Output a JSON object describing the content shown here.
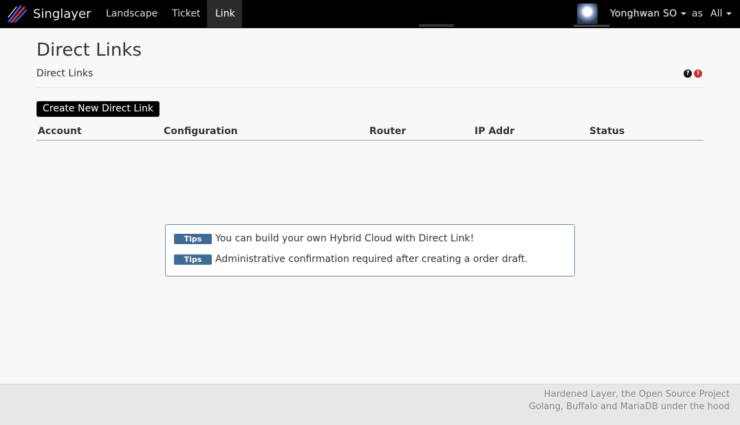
{
  "navbar": {
    "brand": "Singlayer",
    "items": [
      {
        "label": "Landscape",
        "active": false
      },
      {
        "label": "Ticket",
        "active": false
      },
      {
        "label": "Link",
        "active": true
      }
    ],
    "user": {
      "name": "Yonghwan SO",
      "as_label": "as",
      "scope": "All"
    }
  },
  "page": {
    "title": "Direct Links",
    "subtitle": "Direct Links",
    "help_glyph": "?",
    "warn_glyph": "!"
  },
  "actions": {
    "create_label": "Create New Direct Link"
  },
  "table": {
    "columns": [
      "Account",
      "Configuration",
      "Router",
      "IP Addr",
      "Status"
    ],
    "rows": []
  },
  "tips": [
    {
      "badge": "Tips",
      "text": "You can build your own Hybrid Cloud with Direct Link!"
    },
    {
      "badge": "Tips",
      "text": "Administrative confirmation required after creating a order draft."
    }
  ],
  "footer": {
    "line1": "Hardened Layer, the Open Source Project",
    "line2": "Golang, Buffalo and MariaDB under the hood"
  },
  "colors": {
    "navbar_bg": "#000000",
    "tips_badge": "#3f6b95",
    "warn": "#c9302c"
  }
}
